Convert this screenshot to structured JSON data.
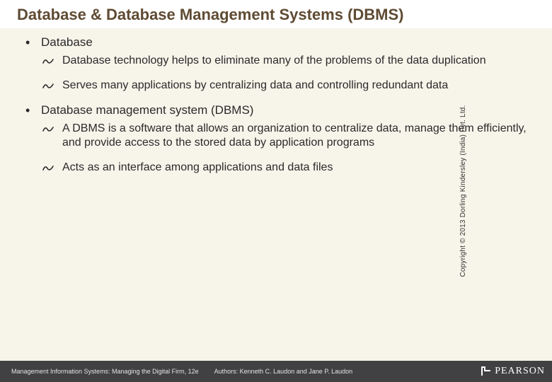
{
  "title": "Database & Database Management Systems (DBMS)",
  "bullets": [
    {
      "label": "Database",
      "sub": [
        "Database technology helps to eliminate many of the problems of the data duplication",
        "Serves many applications by centralizing data and controlling redundant data"
      ]
    },
    {
      "label": "Database management system (DBMS)",
      "sub": [
        "A DBMS is a software that allows an organization to centralize data, manage them efficiently, and provide access to the stored data by application programs",
        "Acts as an interface among applications and data files"
      ]
    }
  ],
  "copyright": "Copyright © 2013 Dorling Kindersley (India) Pvt. Ltd.",
  "footer": {
    "book": "Management Information Systems: Managing the Digital Firm, 12e",
    "authors": "Authors: Kenneth C. Laudon and Jane P. Laudon",
    "brand": "PEARSON"
  }
}
